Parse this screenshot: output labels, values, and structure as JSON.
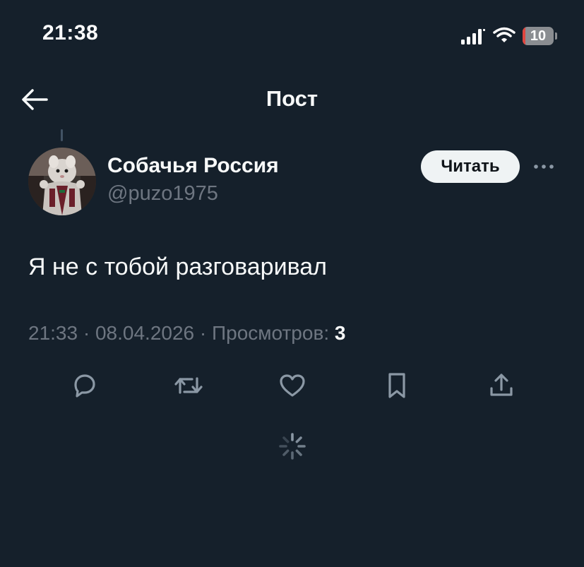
{
  "status_bar": {
    "time": "21:38",
    "battery_level": "10",
    "battery_fraction": 0.1
  },
  "header": {
    "title": "Пост",
    "back_icon": "arrow-left-icon"
  },
  "post": {
    "author": {
      "name": "Собачья Россия",
      "handle": "@puzo1975"
    },
    "follow_label": "Читать",
    "text": "Я не с тобой разговаривал",
    "time": "21:33",
    "date": "08.04.2026",
    "views_label": "Просмотров:",
    "views_count": "3"
  },
  "actions": [
    {
      "name": "reply",
      "icon": "reply-icon"
    },
    {
      "name": "repost",
      "icon": "repost-icon"
    },
    {
      "name": "like",
      "icon": "heart-icon"
    },
    {
      "name": "bookmark",
      "icon": "bookmark-icon"
    },
    {
      "name": "share",
      "icon": "share-icon"
    }
  ],
  "colors": {
    "background": "#15202b",
    "text_primary": "#f7f9f9",
    "text_secondary": "#6e7681",
    "icon": "#8b98a5",
    "follow_button_bg": "#eff3f4",
    "battery_low": "#e0463f"
  }
}
